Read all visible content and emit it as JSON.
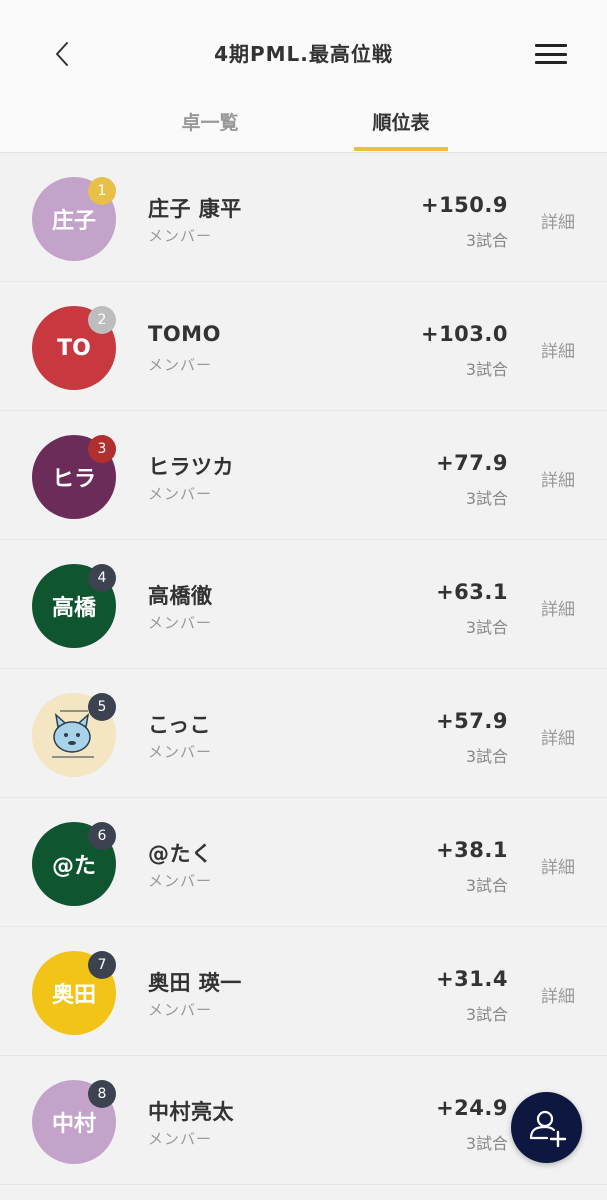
{
  "header": {
    "title": "4期PML.最高位戦",
    "back_icon": "chevron-left-icon",
    "menu_icon": "hamburger-menu-icon"
  },
  "tabs": [
    {
      "label": "卓一覧",
      "active": false
    },
    {
      "label": "順位表",
      "active": true
    }
  ],
  "accent_color": "#e9c047",
  "standings": [
    {
      "rank": "1",
      "avatar_text": "庄子",
      "avatar_color": "#c3a3c9",
      "badge_color": "#e9c047",
      "name": "庄子 康平",
      "role": "メンバー",
      "score": "+150.9",
      "games": "3試合",
      "detail": "詳細"
    },
    {
      "rank": "2",
      "avatar_text": "TO",
      "avatar_color": "#c8393f",
      "badge_color": "#bdbdbd",
      "name": "TOMO",
      "role": "メンバー",
      "score": "+103.0",
      "games": "3試合",
      "detail": "詳細"
    },
    {
      "rank": "3",
      "avatar_text": "ヒラ",
      "avatar_color": "#6b2c5a",
      "badge_color": "#b03030",
      "name": "ヒラツカ",
      "role": "メンバー",
      "score": "+77.9",
      "games": "3試合",
      "detail": "詳細"
    },
    {
      "rank": "4",
      "avatar_text": "高橋",
      "avatar_color": "#0f5530",
      "badge_color": "#3c4250",
      "name": "高橋徹",
      "role": "メンバー",
      "score": "+63.1",
      "games": "3試合",
      "detail": "詳細"
    },
    {
      "rank": "5",
      "avatar_text": "",
      "avatar_color": "#f2e2b8",
      "badge_color": "#3c4250",
      "name": "こっこ",
      "role": "メンバー",
      "score": "+57.9",
      "games": "3試合",
      "detail": "詳細"
    },
    {
      "rank": "6",
      "avatar_text": "@た",
      "avatar_color": "#0f5530",
      "badge_color": "#3c4250",
      "name": "@たく",
      "role": "メンバー",
      "score": "+38.1",
      "games": "3試合",
      "detail": "詳細"
    },
    {
      "rank": "7",
      "avatar_text": "奥田",
      "avatar_color": "#f2c418",
      "badge_color": "#3c4250",
      "name": "奥田 瑛一",
      "role": "メンバー",
      "score": "+31.4",
      "games": "3試合",
      "detail": "詳細"
    },
    {
      "rank": "8",
      "avatar_text": "中村",
      "avatar_color": "#c3a3c9",
      "badge_color": "#3c4250",
      "name": "中村亮太",
      "role": "メンバー",
      "score": "+24.9",
      "games": "3試合",
      "detail": "詳細"
    }
  ],
  "fab_icon": "add-user-icon"
}
